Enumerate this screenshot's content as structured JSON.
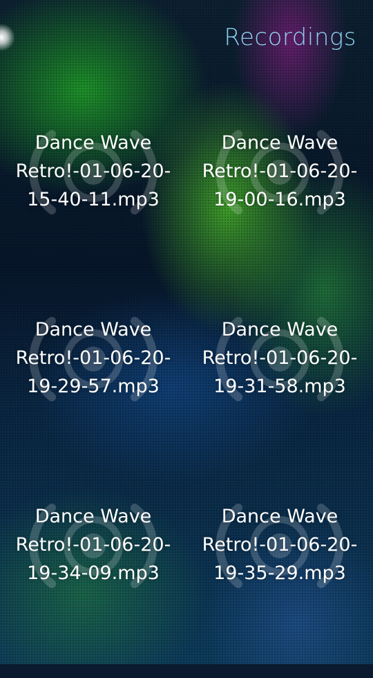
{
  "header": {
    "title": "Recordings"
  },
  "recordings": [
    {
      "name": "Dance Wave Retro!-01-06-20-15-40-11.mp3",
      "line1": "Dance Wave",
      "line2": "Retro!-01-06-20-",
      "line3": "15-40-11.mp3",
      "icon": "radio-waves-icon"
    },
    {
      "name": "Dance Wave Retro!-01-06-20-19-00-16.mp3",
      "line1": "Dance Wave",
      "line2": "Retro!-01-06-20-",
      "line3": "19-00-16.mp3",
      "icon": "radio-waves-icon"
    },
    {
      "name": "Dance Wave Retro!-01-06-20-19-29-57.mp3",
      "line1": "Dance Wave",
      "line2": "Retro!-01-06-20-",
      "line3": "19-29-57.mp3",
      "icon": "radio-waves-icon"
    },
    {
      "name": "Dance Wave Retro!-01-06-20-19-31-58.mp3",
      "line1": "Dance Wave",
      "line2": "Retro!-01-06-20-",
      "line3": "19-31-58.mp3",
      "icon": "radio-waves-icon"
    },
    {
      "name": "Dance Wave Retro!-01-06-20-19-34-09.mp3",
      "line1": "Dance Wave",
      "line2": "Retro!-01-06-20-",
      "line3": "19-34-09.mp3",
      "icon": "radio-waves-icon"
    },
    {
      "name": "Dance Wave Retro!-01-06-20-19-35-29.mp3",
      "line1": "Dance Wave",
      "line2": "Retro!-01-06-20-",
      "line3": "19-35-29.mp3",
      "icon": "radio-waves-icon"
    }
  ],
  "colors": {
    "title": "#8fd0f0",
    "label": "#ffffff"
  }
}
